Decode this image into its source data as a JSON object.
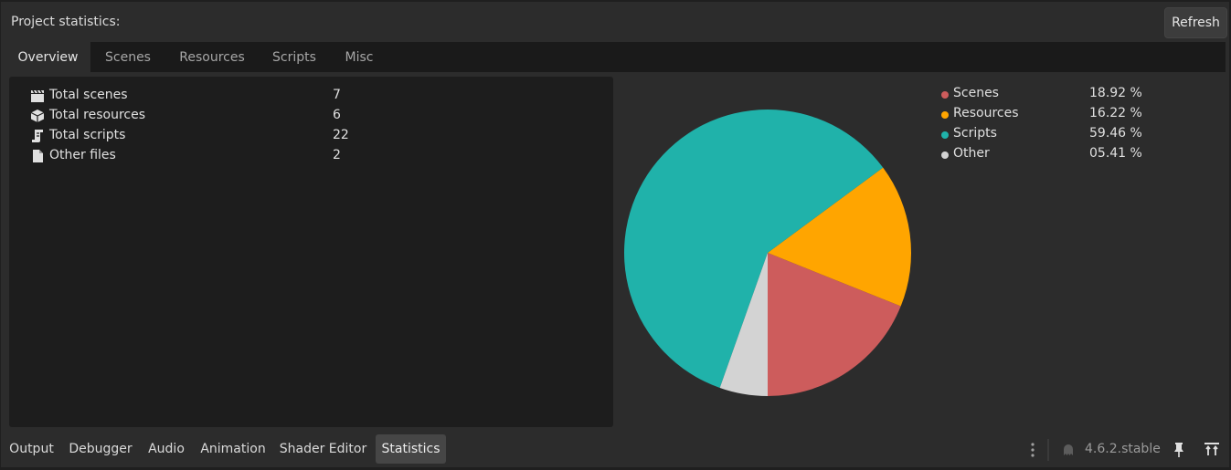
{
  "header": {
    "title": "Project statistics:",
    "refresh_label": "Refresh"
  },
  "tabs": [
    {
      "label": "Overview"
    },
    {
      "label": "Scenes"
    },
    {
      "label": "Resources"
    },
    {
      "label": "Scripts"
    },
    {
      "label": "Misc"
    }
  ],
  "stats": [
    {
      "icon": "clapperboard-icon",
      "label": "Total scenes",
      "value": "7"
    },
    {
      "icon": "cube-icon",
      "label": "Total resources",
      "value": "6"
    },
    {
      "icon": "script-icon",
      "label": "Total scripts",
      "value": "22"
    },
    {
      "icon": "file-icon",
      "label": "Other files",
      "value": "2"
    }
  ],
  "legend": [
    {
      "label": "Scenes",
      "value": "18.92 %"
    },
    {
      "label": "Resources",
      "value": "16.22 %"
    },
    {
      "label": "Scripts",
      "value": "59.46 %"
    },
    {
      "label": "Other",
      "value": "05.41 %"
    }
  ],
  "colors": {
    "scenes": "#cd5c5c",
    "resources": "#ffa500",
    "scripts": "#20b2aa",
    "other": "#d3d3d3"
  },
  "chart_data": {
    "type": "pie",
    "categories": [
      "Scenes",
      "Resources",
      "Scripts",
      "Other"
    ],
    "values": [
      18.92,
      16.22,
      59.46,
      5.41
    ],
    "colors": [
      "#cd5c5c",
      "#ffa500",
      "#20b2aa",
      "#d3d3d3"
    ]
  },
  "bottom_tabs": [
    {
      "label": "Output"
    },
    {
      "label": "Debugger"
    },
    {
      "label": "Audio"
    },
    {
      "label": "Animation"
    },
    {
      "label": "Shader Editor"
    },
    {
      "label": "Statistics"
    }
  ],
  "status": {
    "version": "4.6.2.stable"
  }
}
